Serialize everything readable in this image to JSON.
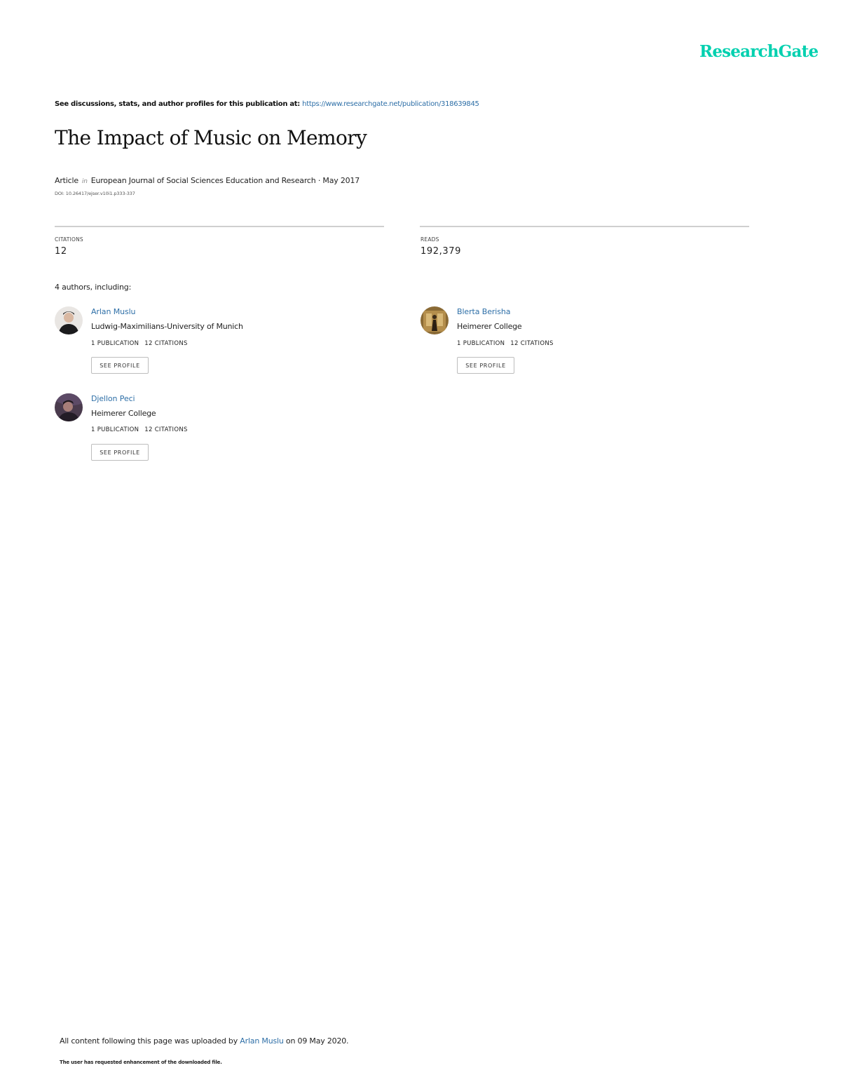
{
  "brand": {
    "logo_text": "ResearchGate",
    "accent_color": "#00d0af",
    "link_color": "#2e6fa7"
  },
  "intro": {
    "text": "See discussions, stats, and author profiles for this publication at: ",
    "link": "https://www.researchgate.net/publication/318639845"
  },
  "publication": {
    "title": "The Impact of Music on Memory",
    "type": "Article",
    "in_label": "in",
    "journal_date": "European Journal of Social Sciences Education and Research · May 2017",
    "doi": "DOI: 10.26417/ejser.v10i1.p333-337"
  },
  "stats": {
    "citations_label": "CITATIONS",
    "citations_value": "12",
    "reads_label": "READS",
    "reads_value": "192,379"
  },
  "authors_heading": "4 authors, including:",
  "authors": [
    {
      "name": "Arlan Muslu",
      "institution": "Ludwig-Maximilians-University of Munich",
      "publications": "1 PUBLICATION",
      "citations": "12 CITATIONS",
      "button": "SEE PROFILE"
    },
    {
      "name": "Blerta Berisha",
      "institution": "Heimerer College",
      "publications": "1 PUBLICATION",
      "citations": "12 CITATIONS",
      "button": "SEE PROFILE"
    },
    {
      "name": "Djellon Peci",
      "institution": "Heimerer College",
      "publications": "1 PUBLICATION",
      "citations": "12 CITATIONS",
      "button": "SEE PROFILE"
    }
  ],
  "footer": {
    "uploaded_prefix": "All content following this page was uploaded by ",
    "uploader": "Arlan Muslu",
    "uploaded_suffix": " on 09 May 2020.",
    "note": "The user has requested enhancement of the downloaded file."
  }
}
